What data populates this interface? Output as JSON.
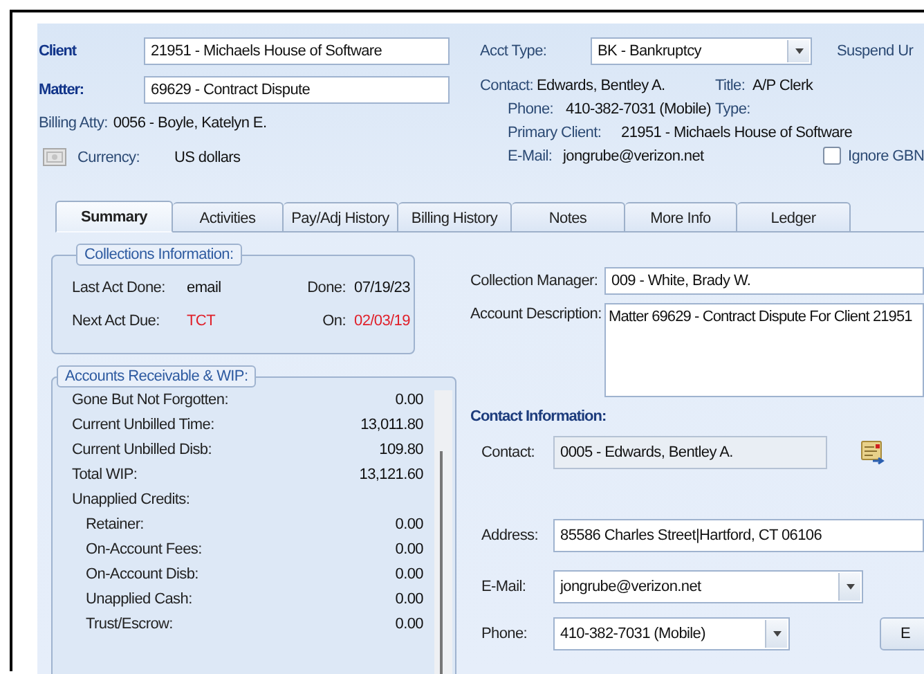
{
  "header": {
    "client": {
      "label": "Client",
      "value": "21951 - Michaels House of Software"
    },
    "matter": {
      "label": "Matter:",
      "value": "69629 - Contract Dispute"
    },
    "billing_atty": {
      "label": "Billing Atty:",
      "value": "0056 - Boyle, Katelyn E."
    },
    "currency": {
      "label": "Currency:",
      "value": "US dollars"
    },
    "acct_type": {
      "label": "Acct Type:",
      "value": "BK - Bankruptcy"
    },
    "suspend": {
      "label": "Suspend Ur"
    },
    "contact": {
      "label": "Contact:",
      "value": "Edwards, Bentley A."
    },
    "title": {
      "label": "Title:",
      "value": "A/P Clerk"
    },
    "phone": {
      "label": "Phone:",
      "value": "410-382-7031 (Mobile)"
    },
    "type": {
      "label": "Type:"
    },
    "primary_client": {
      "label": "Primary Client:",
      "value": "21951 - Michaels House of Software"
    },
    "email": {
      "label": "E-Mail:",
      "value": "jongrube@verizon.net"
    },
    "ignore_gbn": {
      "label": "Ignore GBN",
      "checked": false
    }
  },
  "tabs": [
    {
      "label": "Summary",
      "selected": true
    },
    {
      "label": "Activities",
      "selected": false
    },
    {
      "label": "Pay/Adj History",
      "selected": false
    },
    {
      "label": "Billing History",
      "selected": false
    },
    {
      "label": "Notes",
      "selected": false
    },
    {
      "label": "More Info",
      "selected": false
    },
    {
      "label": "Ledger",
      "selected": false
    }
  ],
  "collections": {
    "title": "Collections Information:",
    "rows": [
      {
        "label": "Last Act Done:",
        "value": "email",
        "date_label": "Done:",
        "date": "07/19/23",
        "overdue": false
      },
      {
        "label": "Next Act Due:",
        "value": "TCT",
        "date_label": "On:",
        "date": "02/03/19",
        "overdue": true
      }
    ]
  },
  "accounts": {
    "title": "Accounts Receivable & WIP:",
    "rows": [
      {
        "label": "Gone But Not Forgotten:",
        "value": "0.00"
      },
      {
        "label": "Current Unbilled Time:",
        "value": "13,011.80"
      },
      {
        "label": "Current Unbilled Disb:",
        "value": "109.80"
      },
      {
        "label": "Total WIP:",
        "value": "13,121.60"
      },
      {
        "label": "Unapplied Credits:",
        "children": [
          {
            "label": "Retainer:",
            "value": "0.00"
          },
          {
            "label": "On-Account Fees:",
            "value": "0.00"
          },
          {
            "label": "On-Account Disb:",
            "value": "0.00"
          },
          {
            "label": "Unapplied Cash:",
            "value": "0.00"
          },
          {
            "label": "Trust/Escrow:",
            "value": "0.00"
          }
        ]
      }
    ]
  },
  "collection_manager": {
    "label": "Collection Manager:",
    "value": "009 - White, Brady W."
  },
  "account_description": {
    "label": "Account Description:",
    "value": "Matter 69629 - Contract Dispute For Client 21951"
  },
  "contact_information": {
    "title": "Contact Information:",
    "contact": {
      "label": "Contact:",
      "value": "0005 - Edwards, Bentley A."
    },
    "address": {
      "label": "Address:",
      "value": "85586 Charles Street|Hartford, CT 06106"
    },
    "email": {
      "label": "E-Mail:",
      "value": "jongrube@verizon.net"
    },
    "phone": {
      "label": "Phone:",
      "value": "410-382-7031 (Mobile)"
    },
    "button": "E"
  }
}
